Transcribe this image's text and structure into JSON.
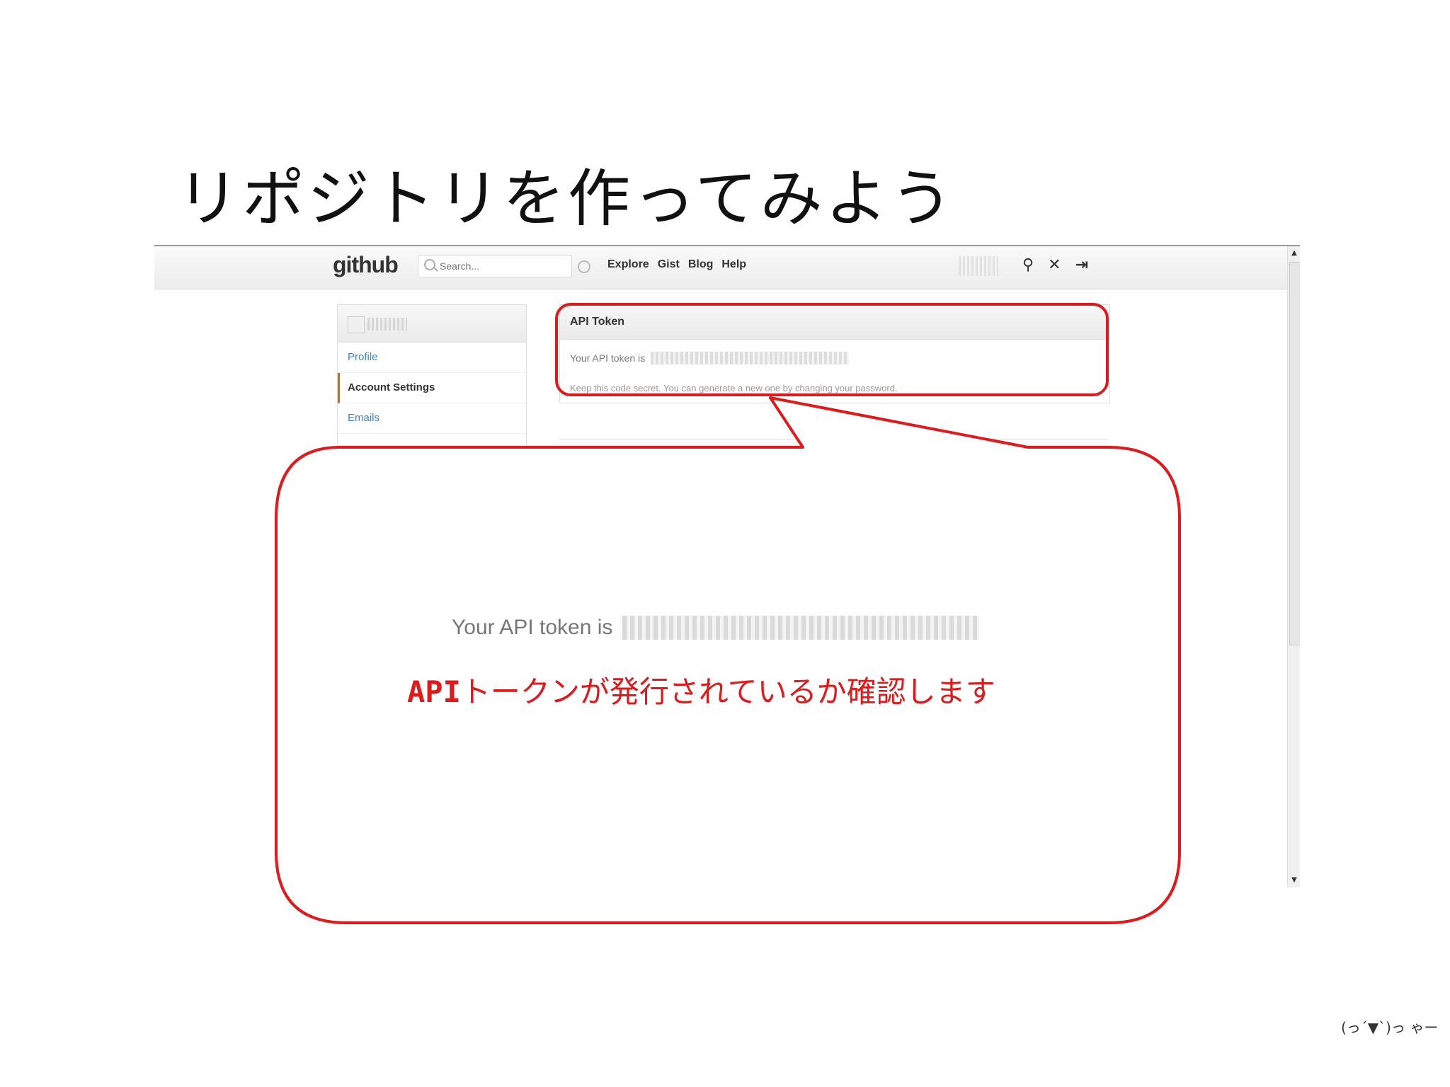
{
  "slide": {
    "title": "リポジトリを作ってみよう",
    "footer": "(っ´▼`)っ ゃー"
  },
  "github": {
    "logo": "github",
    "search_placeholder": "Search...",
    "nav": [
      "Explore",
      "Gist",
      "Blog",
      "Help"
    ],
    "tools": [
      "antenna-icon",
      "tools-icon",
      "logout-icon"
    ]
  },
  "sidebar": {
    "items": [
      {
        "label": "Profile"
      },
      {
        "label": "Account Settings"
      },
      {
        "label": "Emails"
      }
    ]
  },
  "token_box": {
    "heading": "API Token",
    "token_label": "Your API token is",
    "note": "Keep this code secret. You can generate a new one by changing your password."
  },
  "callout": {
    "token_label": "Your API token is",
    "message_prefix": "API",
    "message_rest": "トークンが発行されているか確認します",
    "accent_color": "#e01a1a"
  }
}
